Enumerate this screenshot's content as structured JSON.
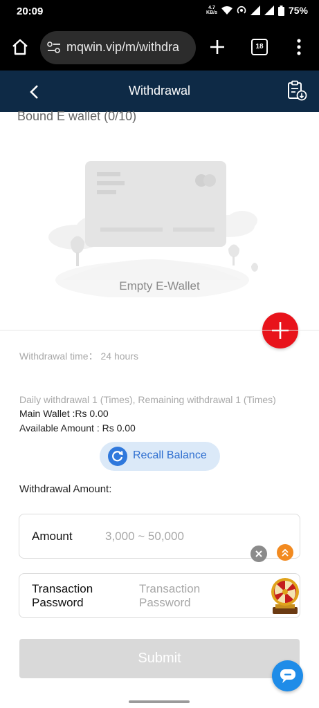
{
  "status_bar": {
    "time": "20:09",
    "net_speed_value": "4.7",
    "net_speed_unit": "KB/s",
    "battery": "75%"
  },
  "browser": {
    "url": "mqwin.vip/m/withdra",
    "tab_count": "18"
  },
  "header": {
    "title": "Withdrawal"
  },
  "wallet": {
    "section_title": "Bound E wallet (0/10)",
    "empty_text": "Empty E-Wallet"
  },
  "info": {
    "withdrawal_time_label": "Withdrawal time：",
    "withdrawal_time_value": "24 hours",
    "daily_limit": "Daily withdrawal 1 (Times), Remaining withdrawal 1 (Times)",
    "main_wallet": "Main Wallet :Rs 0.00",
    "available_amount": "Available Amount : Rs 0.00"
  },
  "recall": {
    "label": "Recall Balance"
  },
  "form": {
    "section_label": "Withdrawal Amount:",
    "amount_label": "Amount",
    "amount_placeholder": "3,000 ~ 50,000",
    "password_label_line1": "Transaction",
    "password_label_line2": "Password",
    "password_placeholder_line1": "Transaction",
    "password_placeholder_line2": "Password",
    "submit_label": "Submit"
  },
  "colors": {
    "header_bg": "#0e2a46",
    "add_button": "#e8131b",
    "recall_bg": "#dbe9f8",
    "recall_accent": "#2f78dc",
    "submit_disabled": "#d9d9d9",
    "chat_button": "#1f8ce8"
  },
  "icons": [
    "home-icon",
    "site-settings-icon",
    "plus-icon",
    "tab-switcher-icon",
    "overflow-menu-icon",
    "back-arrow-icon",
    "record-download-icon",
    "card-illustration",
    "add-icon",
    "refresh-icon",
    "close-icon",
    "chevron-up-icon",
    "prize-wheel-icon",
    "chat-icon"
  ]
}
